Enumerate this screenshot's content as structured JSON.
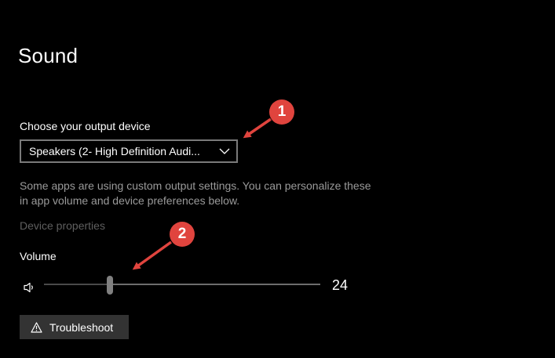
{
  "page": {
    "title": "Sound"
  },
  "output": {
    "label": "Choose your output device",
    "selected_device": "Speakers (2- High Definition Audi...",
    "info_text": "Some apps are using custom output settings. You can personalize these in app volume and device preferences below.",
    "device_properties_link": "Device properties"
  },
  "volume": {
    "label": "Volume",
    "value": "24",
    "level_fraction": 0.24,
    "icon": "speaker-icon"
  },
  "troubleshoot": {
    "label": "Troubleshoot",
    "icon": "warning-icon"
  },
  "annotations": [
    {
      "number": "1",
      "color": "#e0443e"
    },
    {
      "number": "2",
      "color": "#e0443e"
    }
  ],
  "colors": {
    "background": "#000000",
    "accent_annotation": "#e0443e",
    "muted_text": "#9a9a9a",
    "disabled_text": "#5f5f5f",
    "button_bg": "#333333"
  }
}
